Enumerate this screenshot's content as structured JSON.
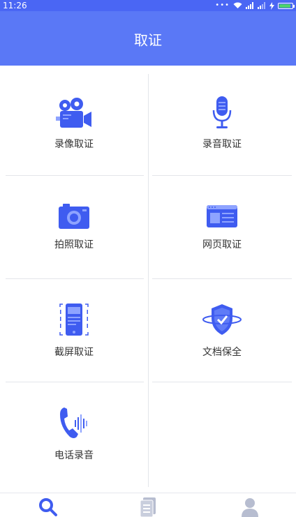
{
  "status_bar": {
    "time": "11:26",
    "dots": "•••"
  },
  "header": {
    "title": "取证"
  },
  "tiles": [
    {
      "label": "录像取证",
      "icon": "video-camera-icon"
    },
    {
      "label": "录音取证",
      "icon": "microphone-icon"
    },
    {
      "label": "拍照取证",
      "icon": "camera-icon"
    },
    {
      "label": "网页取证",
      "icon": "webpage-icon"
    },
    {
      "label": "截屏取证",
      "icon": "phone-screenshot-icon"
    },
    {
      "label": "文档保全",
      "icon": "shield-icon"
    },
    {
      "label": "电话录音",
      "icon": "phone-call-icon"
    }
  ],
  "bottom_nav": [
    {
      "icon": "search-icon",
      "active": true
    },
    {
      "icon": "document-list-icon",
      "active": false
    },
    {
      "icon": "user-icon",
      "active": false
    }
  ],
  "colors": {
    "primary": "#5a78f6",
    "icon_blue": "#3f5cf0",
    "icon_light": "#8ea3ff",
    "inactive": "#b7bdd0"
  }
}
